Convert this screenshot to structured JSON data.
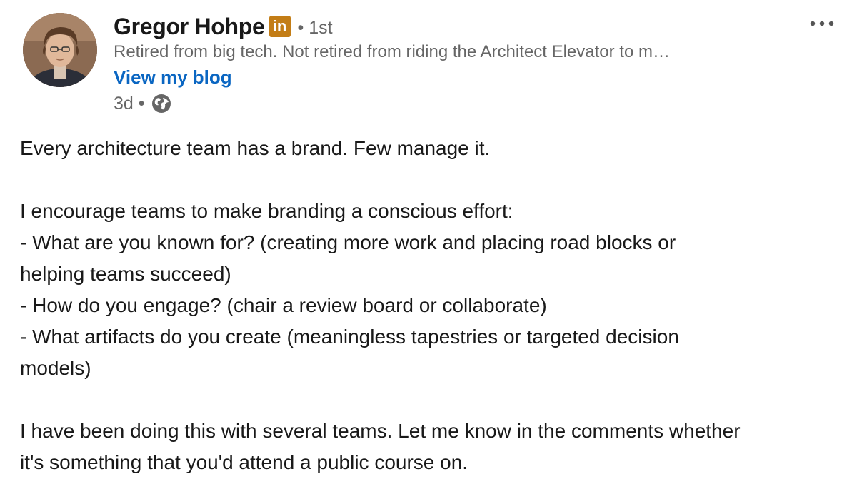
{
  "author": {
    "name": "Gregor Hohpe",
    "badge": "in",
    "degree": "• 1st",
    "headline": "Retired from big tech. Not retired from riding the Architect Elevator to m…",
    "blog_link": "View my blog",
    "posted_ago": "3d •",
    "visibility_icon": "globe-icon",
    "avatar_icon": "profile-photo"
  },
  "menu": {
    "more_icon": "ellipsis-icon"
  },
  "post": {
    "lines": [
      "Every architecture team has a brand. Few manage it.",
      "",
      "I encourage teams to make branding a conscious effort:",
      "- What are you known for? (creating more work and placing road blocks or",
      "helping teams succeed)",
      "- How do you engage? (chair a review board or collaborate)",
      "- What artifacts do you create (meaningless tapestries or targeted decision",
      "models)",
      "",
      "I have been doing this with several teams. Let me know in the comments whether",
      "it's something that you'd attend a public course on."
    ]
  },
  "colors": {
    "link": "#0a66c2",
    "badge": "#c37d16",
    "secondary_text": "#666666",
    "primary_text": "#191919"
  }
}
